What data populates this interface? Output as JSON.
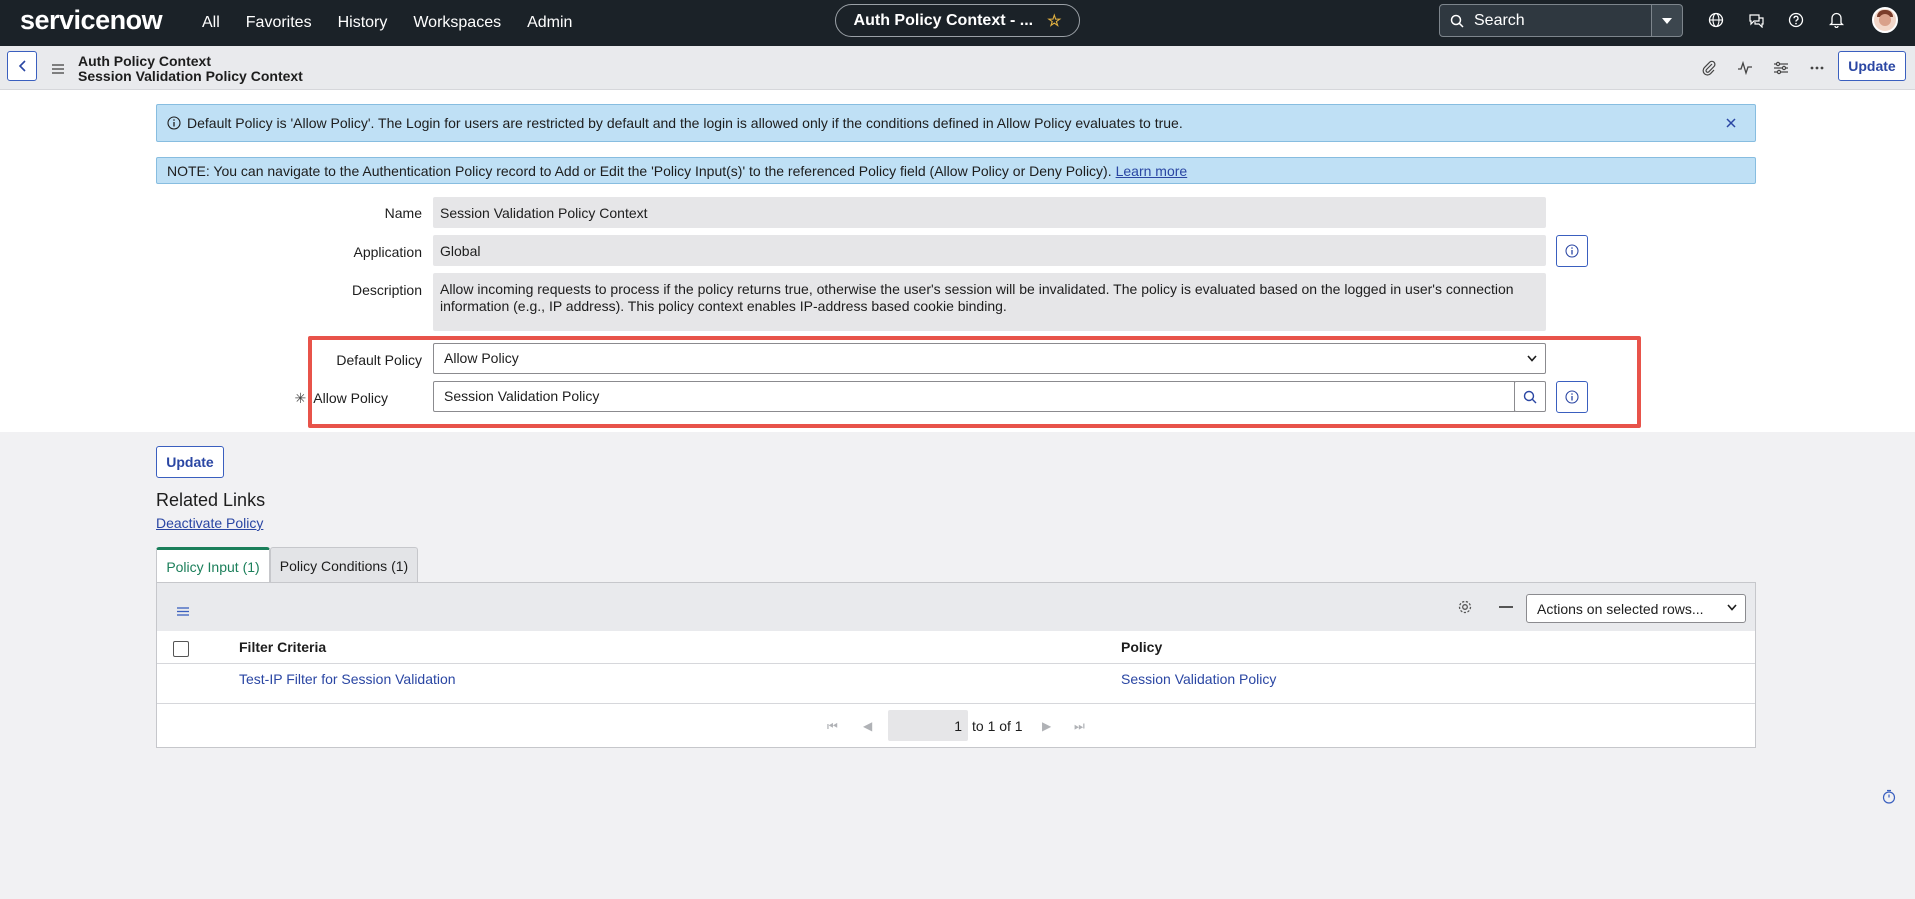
{
  "topnav": {
    "logo": "servicenow",
    "links": [
      "All",
      "Favorites",
      "History",
      "Workspaces",
      "Admin"
    ],
    "context_title": "Auth Policy Context - ...",
    "search_placeholder": "Search"
  },
  "header": {
    "title_line1": "Auth Policy Context",
    "title_line2": "Session Validation Policy Context",
    "update_label": "Update"
  },
  "messages": {
    "info": "Default Policy is 'Allow Policy'. The Login for users are restricted by default and the login is allowed only if the conditions defined in Allow Policy evaluates to true.",
    "note": "NOTE: You can navigate to the Authentication Policy record to Add or Edit the 'Policy Input(s)' to the referenced Policy field (Allow Policy or Deny Policy).",
    "note_link": "Learn more"
  },
  "form": {
    "name_label": "Name",
    "name_value": "Session Validation Policy Context",
    "application_label": "Application",
    "application_value": "Global",
    "description_label": "Description",
    "description_value": "Allow incoming requests to process if the policy returns true, otherwise the user's session will be invalidated. The policy is evaluated based on the logged in user's connection information (e.g., IP address). This policy context enables IP-address based cookie binding.",
    "default_policy_label": "Default Policy",
    "default_policy_value": "Allow Policy",
    "allow_policy_label": "Allow Policy",
    "allow_policy_value": "Session Validation Policy",
    "required_marker": "✳"
  },
  "footer": {
    "update_label": "Update",
    "related_links_title": "Related Links",
    "deactivate_link": "Deactivate Policy"
  },
  "tabs": [
    {
      "label": "Policy Input (1)",
      "active": true
    },
    {
      "label": "Policy Conditions (1)",
      "active": false
    }
  ],
  "list": {
    "actions_placeholder": "Actions on selected rows...",
    "columns": [
      "Filter Criteria",
      "Policy"
    ],
    "rows": [
      [
        "Test-IP Filter for Session Validation",
        "Session Validation Policy"
      ]
    ],
    "pager": {
      "current": "1",
      "text": "to 1 of 1"
    }
  },
  "colors": {
    "nav_bg": "#1b2228",
    "accent": "#2a46a3",
    "highlight": "#e8534a",
    "active_tab": "#1b7f5a",
    "info_bg": "#bfe0f5"
  }
}
